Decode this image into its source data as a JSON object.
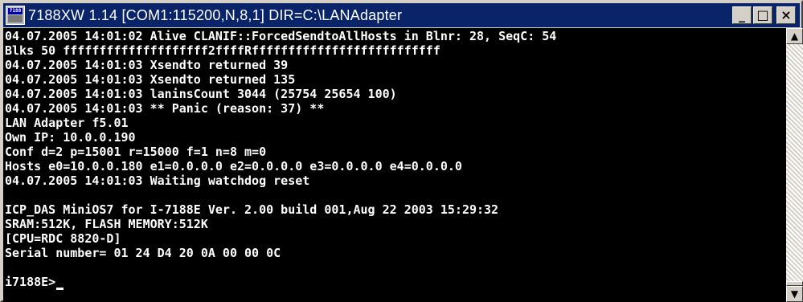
{
  "window": {
    "title": "7188XW 1.14 [COM1:115200,N,8,1] DIR=C:\\LANAdapter",
    "icon_label": "7188",
    "controls": {
      "minimize": "_",
      "maximize": "□",
      "close": "×"
    }
  },
  "console": {
    "lines": [
      "04.07.2005 14:01:02 Alive CLANIF::ForcedSendtoAllHosts in Blnr: 28, SeqC: 54",
      "Blks 50 ffffffffffffffffffff2ffffRffffffffffffffffffffffffff",
      "04.07.2005 14:01:03 Xsendto returned 39",
      "04.07.2005 14:01:03 Xsendto returned 135",
      "04.07.2005 14:01:03 laninsCount 3044 (25754 25654 100)",
      "04.07.2005 14:01:03 ** Panic (reason: 37) **",
      "LAN Adapter f5.01",
      "Own IP: 10.0.0.190",
      "Conf d=2 p=15001 r=15000 f=1 n=8 m=0",
      "Hosts e0=10.0.0.180 e1=0.0.0.0 e2=0.0.0.0 e3=0.0.0.0 e4=0.0.0.0",
      "04.07.2005 14:01:03 Waiting watchdog reset",
      "",
      "ICP_DAS MiniOS7 for I-7188E Ver. 2.00 build 001,Aug 22 2003 15:29:32",
      "SRAM:512K, FLASH MEMORY:512K",
      "[CPU=RDC 8820-D]",
      "Serial number= 01 24 D4 20 0A 00 00 0C",
      "",
      "i7188E>"
    ]
  },
  "scrollbar": {
    "up_arrow": "▲",
    "down_arrow": "▼"
  }
}
